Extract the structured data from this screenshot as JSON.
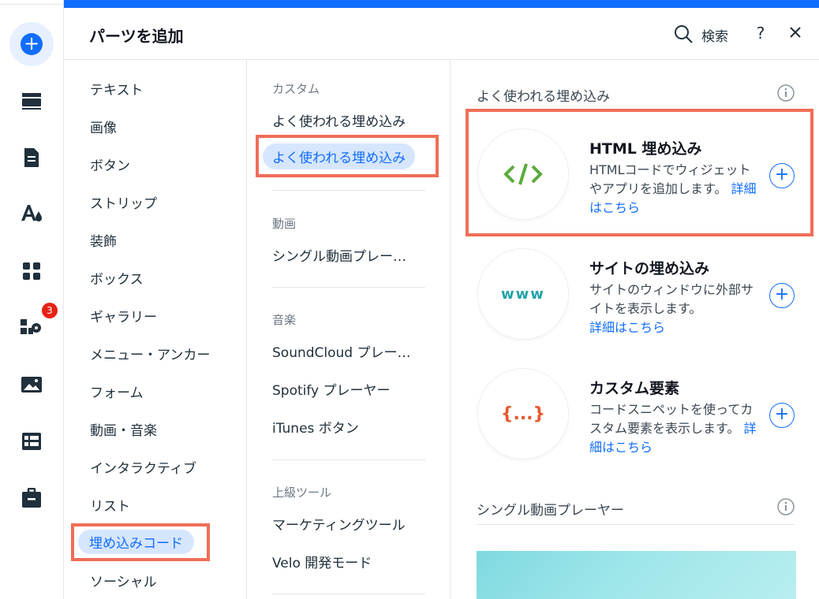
{
  "header": {
    "title": "パーツを追加",
    "search_label": "検索",
    "help_label": "?"
  },
  "rail": {
    "badge_count": "3",
    "accent_color": "#116dff"
  },
  "categories": [
    {
      "label": "テキスト"
    },
    {
      "label": "画像"
    },
    {
      "label": "ボタン"
    },
    {
      "label": "ストリップ"
    },
    {
      "label": "装飾"
    },
    {
      "label": "ボックス"
    },
    {
      "label": "ギャラリー"
    },
    {
      "label": "メニュー・アンカー"
    },
    {
      "label": "フォーム"
    },
    {
      "label": "動画・音楽"
    },
    {
      "label": "インタラクティブ"
    },
    {
      "label": "リスト"
    },
    {
      "label": "埋め込みコード"
    },
    {
      "label": "ソーシャル"
    }
  ],
  "selected_category": "埋め込みコード",
  "subnav": {
    "custom_head": "カスタム",
    "custom_items": [
      "よく使われる埋め込み",
      "よく使われる埋め込み"
    ],
    "video_head": "動画",
    "video_items": [
      "シングル動画プレー…"
    ],
    "music_head": "音楽",
    "music_items": [
      "SoundCloud プレー…",
      "Spotify プレーヤー",
      "iTunes ボタン"
    ],
    "advanced_head": "上級ツール",
    "advanced_items": [
      "マーケティングツール",
      "Velo 開発モード"
    ]
  },
  "content": {
    "section_popular": "よく使われる埋め込み",
    "section_video": "シングル動画プレーヤー",
    "cards": [
      {
        "title": "HTML 埋め込み",
        "icon_glyph": "</>",
        "desc": "HTMLコードでウィジェットやアプリを追加します。",
        "link": "詳細はこちら"
      },
      {
        "title": "サイトの埋め込み",
        "icon_glyph": "www",
        "desc": "サイトのウィンドウに外部サイトを表示します。",
        "link": "詳細はこちら"
      },
      {
        "title": "カスタム要素",
        "icon_glyph": "{...}",
        "desc": "コードスニペットを使ってカスタム要素を表示します。",
        "link": "詳細はこちら"
      }
    ]
  },
  "colors": {
    "highlight": "#f06e57",
    "selected_bg": "#d6e6fe",
    "link": "#116dff"
  }
}
